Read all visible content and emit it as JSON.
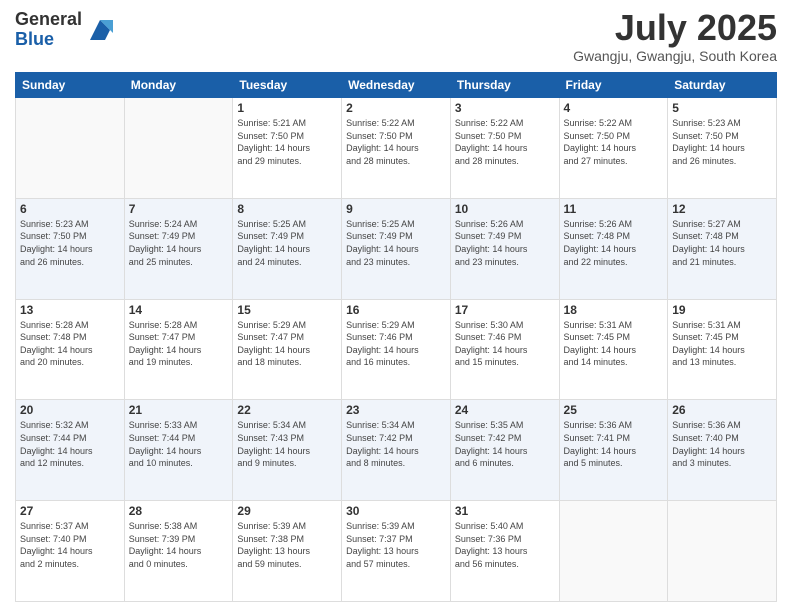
{
  "logo": {
    "general": "General",
    "blue": "Blue"
  },
  "header": {
    "month": "July 2025",
    "location": "Gwangju, Gwangju, South Korea"
  },
  "weekdays": [
    "Sunday",
    "Monday",
    "Tuesday",
    "Wednesday",
    "Thursday",
    "Friday",
    "Saturday"
  ],
  "weeks": [
    [
      {
        "day": "",
        "info": ""
      },
      {
        "day": "",
        "info": ""
      },
      {
        "day": "1",
        "info": "Sunrise: 5:21 AM\nSunset: 7:50 PM\nDaylight: 14 hours\nand 29 minutes."
      },
      {
        "day": "2",
        "info": "Sunrise: 5:22 AM\nSunset: 7:50 PM\nDaylight: 14 hours\nand 28 minutes."
      },
      {
        "day": "3",
        "info": "Sunrise: 5:22 AM\nSunset: 7:50 PM\nDaylight: 14 hours\nand 28 minutes."
      },
      {
        "day": "4",
        "info": "Sunrise: 5:22 AM\nSunset: 7:50 PM\nDaylight: 14 hours\nand 27 minutes."
      },
      {
        "day": "5",
        "info": "Sunrise: 5:23 AM\nSunset: 7:50 PM\nDaylight: 14 hours\nand 26 minutes."
      }
    ],
    [
      {
        "day": "6",
        "info": "Sunrise: 5:23 AM\nSunset: 7:50 PM\nDaylight: 14 hours\nand 26 minutes."
      },
      {
        "day": "7",
        "info": "Sunrise: 5:24 AM\nSunset: 7:49 PM\nDaylight: 14 hours\nand 25 minutes."
      },
      {
        "day": "8",
        "info": "Sunrise: 5:25 AM\nSunset: 7:49 PM\nDaylight: 14 hours\nand 24 minutes."
      },
      {
        "day": "9",
        "info": "Sunrise: 5:25 AM\nSunset: 7:49 PM\nDaylight: 14 hours\nand 23 minutes."
      },
      {
        "day": "10",
        "info": "Sunrise: 5:26 AM\nSunset: 7:49 PM\nDaylight: 14 hours\nand 23 minutes."
      },
      {
        "day": "11",
        "info": "Sunrise: 5:26 AM\nSunset: 7:48 PM\nDaylight: 14 hours\nand 22 minutes."
      },
      {
        "day": "12",
        "info": "Sunrise: 5:27 AM\nSunset: 7:48 PM\nDaylight: 14 hours\nand 21 minutes."
      }
    ],
    [
      {
        "day": "13",
        "info": "Sunrise: 5:28 AM\nSunset: 7:48 PM\nDaylight: 14 hours\nand 20 minutes."
      },
      {
        "day": "14",
        "info": "Sunrise: 5:28 AM\nSunset: 7:47 PM\nDaylight: 14 hours\nand 19 minutes."
      },
      {
        "day": "15",
        "info": "Sunrise: 5:29 AM\nSunset: 7:47 PM\nDaylight: 14 hours\nand 18 minutes."
      },
      {
        "day": "16",
        "info": "Sunrise: 5:29 AM\nSunset: 7:46 PM\nDaylight: 14 hours\nand 16 minutes."
      },
      {
        "day": "17",
        "info": "Sunrise: 5:30 AM\nSunset: 7:46 PM\nDaylight: 14 hours\nand 15 minutes."
      },
      {
        "day": "18",
        "info": "Sunrise: 5:31 AM\nSunset: 7:45 PM\nDaylight: 14 hours\nand 14 minutes."
      },
      {
        "day": "19",
        "info": "Sunrise: 5:31 AM\nSunset: 7:45 PM\nDaylight: 14 hours\nand 13 minutes."
      }
    ],
    [
      {
        "day": "20",
        "info": "Sunrise: 5:32 AM\nSunset: 7:44 PM\nDaylight: 14 hours\nand 12 minutes."
      },
      {
        "day": "21",
        "info": "Sunrise: 5:33 AM\nSunset: 7:44 PM\nDaylight: 14 hours\nand 10 minutes."
      },
      {
        "day": "22",
        "info": "Sunrise: 5:34 AM\nSunset: 7:43 PM\nDaylight: 14 hours\nand 9 minutes."
      },
      {
        "day": "23",
        "info": "Sunrise: 5:34 AM\nSunset: 7:42 PM\nDaylight: 14 hours\nand 8 minutes."
      },
      {
        "day": "24",
        "info": "Sunrise: 5:35 AM\nSunset: 7:42 PM\nDaylight: 14 hours\nand 6 minutes."
      },
      {
        "day": "25",
        "info": "Sunrise: 5:36 AM\nSunset: 7:41 PM\nDaylight: 14 hours\nand 5 minutes."
      },
      {
        "day": "26",
        "info": "Sunrise: 5:36 AM\nSunset: 7:40 PM\nDaylight: 14 hours\nand 3 minutes."
      }
    ],
    [
      {
        "day": "27",
        "info": "Sunrise: 5:37 AM\nSunset: 7:40 PM\nDaylight: 14 hours\nand 2 minutes."
      },
      {
        "day": "28",
        "info": "Sunrise: 5:38 AM\nSunset: 7:39 PM\nDaylight: 14 hours\nand 0 minutes."
      },
      {
        "day": "29",
        "info": "Sunrise: 5:39 AM\nSunset: 7:38 PM\nDaylight: 13 hours\nand 59 minutes."
      },
      {
        "day": "30",
        "info": "Sunrise: 5:39 AM\nSunset: 7:37 PM\nDaylight: 13 hours\nand 57 minutes."
      },
      {
        "day": "31",
        "info": "Sunrise: 5:40 AM\nSunset: 7:36 PM\nDaylight: 13 hours\nand 56 minutes."
      },
      {
        "day": "",
        "info": ""
      },
      {
        "day": "",
        "info": ""
      }
    ]
  ]
}
